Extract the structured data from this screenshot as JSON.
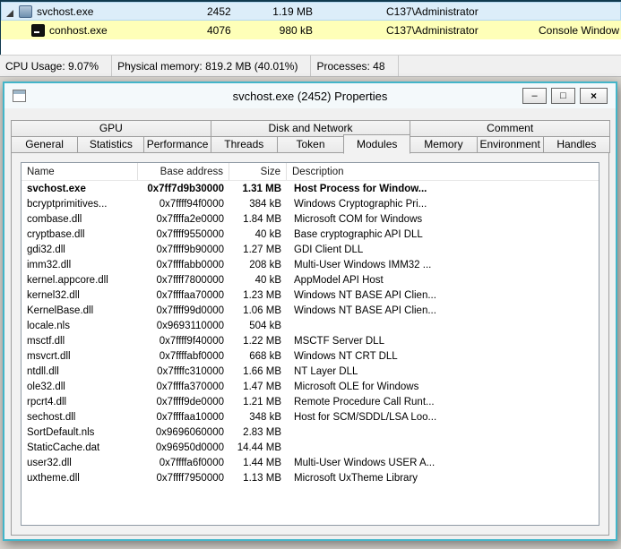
{
  "colors": {
    "dialog_border": "#43b5c9",
    "highlight_new": "#feffb8",
    "highlight_selected": "#dcedf9"
  },
  "process_list": {
    "rows": [
      {
        "name": "svchost.exe",
        "pid": "2452",
        "memory": "1.19 MB",
        "user": "C137\\Administrator",
        "description": ""
      },
      {
        "name": "conhost.exe",
        "pid": "4076",
        "memory": "980 kB",
        "user": "C137\\Administrator",
        "description": "Console Window H"
      }
    ]
  },
  "status_bar": {
    "items": [
      "CPU Usage: 9.07%",
      "Physical memory: 819.2 MB (40.01%)",
      "Processes: 48"
    ]
  },
  "dialog": {
    "title": "svchost.exe (2452) Properties",
    "window_buttons": {
      "minimize": "–",
      "maximize": "□",
      "close": "×"
    },
    "tabs_row1": [
      {
        "label": "GPU"
      },
      {
        "label": "Disk and Network"
      },
      {
        "label": "Comment"
      }
    ],
    "tabs_row2": [
      {
        "label": "General"
      },
      {
        "label": "Statistics"
      },
      {
        "label": "Performance"
      },
      {
        "label": "Threads"
      },
      {
        "label": "Token"
      },
      {
        "label": "Modules",
        "class": "active"
      },
      {
        "label": "Memory"
      },
      {
        "label": "Environment"
      },
      {
        "label": "Handles"
      }
    ],
    "modules_table": {
      "columns": {
        "name": "Name",
        "base": "Base address",
        "size": "Size",
        "description": "Description"
      },
      "rows": [
        {
          "name": "svchost.exe",
          "base": "0x7ff7d9b30000",
          "size": "1.31 MB",
          "description": "Host Process for Window...",
          "class": "bold"
        },
        {
          "name": "bcryptprimitives...",
          "base": "0x7ffff94f0000",
          "size": "384 kB",
          "description": "Windows Cryptographic Pri..."
        },
        {
          "name": "combase.dll",
          "base": "0x7ffffa2e0000",
          "size": "1.84 MB",
          "description": "Microsoft COM for Windows"
        },
        {
          "name": "cryptbase.dll",
          "base": "0x7ffff9550000",
          "size": "40 kB",
          "description": "Base cryptographic API DLL"
        },
        {
          "name": "gdi32.dll",
          "base": "0x7ffff9b90000",
          "size": "1.27 MB",
          "description": "GDI Client DLL"
        },
        {
          "name": "imm32.dll",
          "base": "0x7ffffabb0000",
          "size": "208 kB",
          "description": "Multi-User Windows IMM32 ..."
        },
        {
          "name": "kernel.appcore.dll",
          "base": "0x7ffff7800000",
          "size": "40 kB",
          "description": "AppModel API Host"
        },
        {
          "name": "kernel32.dll",
          "base": "0x7ffffaa70000",
          "size": "1.23 MB",
          "description": "Windows NT BASE API Clien..."
        },
        {
          "name": "KernelBase.dll",
          "base": "0x7ffff99d0000",
          "size": "1.06 MB",
          "description": "Windows NT BASE API Clien..."
        },
        {
          "name": "locale.nls",
          "base": "0x9693110000",
          "size": "504 kB",
          "description": ""
        },
        {
          "name": "msctf.dll",
          "base": "0x7ffff9f40000",
          "size": "1.22 MB",
          "description": "MSCTF Server DLL"
        },
        {
          "name": "msvcrt.dll",
          "base": "0x7ffffabf0000",
          "size": "668 kB",
          "description": "Windows NT CRT DLL"
        },
        {
          "name": "ntdll.dll",
          "base": "0x7ffffc310000",
          "size": "1.66 MB",
          "description": "NT Layer DLL"
        },
        {
          "name": "ole32.dll",
          "base": "0x7ffffa370000",
          "size": "1.47 MB",
          "description": "Microsoft OLE for Windows"
        },
        {
          "name": "rpcrt4.dll",
          "base": "0x7ffff9de0000",
          "size": "1.21 MB",
          "description": "Remote Procedure Call Runt..."
        },
        {
          "name": "sechost.dll",
          "base": "0x7ffffaa10000",
          "size": "348 kB",
          "description": "Host for SCM/SDDL/LSA Loo..."
        },
        {
          "name": "SortDefault.nls",
          "base": "0x9696060000",
          "size": "2.83 MB",
          "description": ""
        },
        {
          "name": "StaticCache.dat",
          "base": "0x96950d0000",
          "size": "14.44 MB",
          "description": ""
        },
        {
          "name": "user32.dll",
          "base": "0x7ffffa6f0000",
          "size": "1.44 MB",
          "description": "Multi-User Windows USER A..."
        },
        {
          "name": "uxtheme.dll",
          "base": "0x7ffff7950000",
          "size": "1.13 MB",
          "description": "Microsoft UxTheme Library"
        }
      ]
    }
  }
}
